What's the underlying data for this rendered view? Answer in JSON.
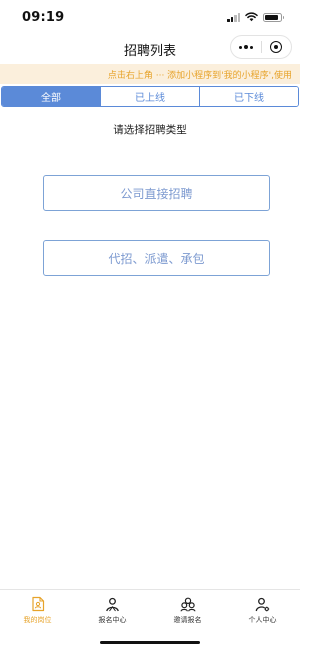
{
  "status_bar": {
    "time": "09:19",
    "battery_level": 0.85
  },
  "nav": {
    "title": "招聘列表"
  },
  "hint_banner": {
    "text": "点击右上角 ··· 添加小程序到'我的小程序',使用"
  },
  "tabs": [
    {
      "label": "全部",
      "active": true
    },
    {
      "label": "已上线",
      "active": false
    },
    {
      "label": "已下线",
      "active": false
    }
  ],
  "main": {
    "prompt": "请选择招聘类型",
    "options": [
      {
        "label": "公司直接招聘"
      },
      {
        "label": "代招、派遣、承包"
      }
    ]
  },
  "tabbar": {
    "accent_color": "#e7a32a",
    "items": [
      {
        "label": "我的岗位",
        "icon": "job-file-icon",
        "active": true
      },
      {
        "label": "报名中心",
        "icon": "person-icon",
        "active": false
      },
      {
        "label": "邀请报名",
        "icon": "users-icon",
        "active": false
      },
      {
        "label": "个人中心",
        "icon": "user-settings-icon",
        "active": false
      }
    ]
  }
}
